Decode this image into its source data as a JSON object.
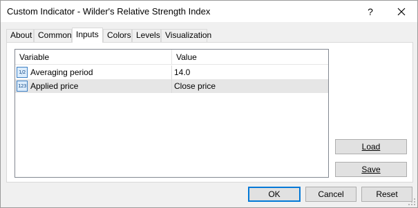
{
  "window": {
    "title": "Custom Indicator - Wilder's Relative Strength Index",
    "help_label": "?",
    "close_label": "close"
  },
  "tabs": [
    {
      "label": "About"
    },
    {
      "label": "Common"
    },
    {
      "label": "Inputs",
      "active": true
    },
    {
      "label": "Colors"
    },
    {
      "label": "Levels"
    },
    {
      "label": "Visualization"
    }
  ],
  "grid": {
    "headers": {
      "variable": "Variable",
      "value": "Value"
    },
    "rows": [
      {
        "icon": "number-parameter-icon",
        "icon_text": "1/2",
        "variable": "Averaging period",
        "value": "14.0"
      },
      {
        "icon": "enum-parameter-icon",
        "icon_text": "123",
        "variable": "Applied price",
        "value": "Close price",
        "selected": true
      }
    ]
  },
  "side_buttons": {
    "load_label": "Load",
    "save_label": "Save"
  },
  "footer": {
    "ok_label": "OK",
    "cancel_label": "Cancel",
    "reset_label": "Reset"
  },
  "colors": {
    "accent": "#0078d7",
    "selected_row": "#e6e6e6",
    "dialog_bg": "#f0f0f0"
  }
}
